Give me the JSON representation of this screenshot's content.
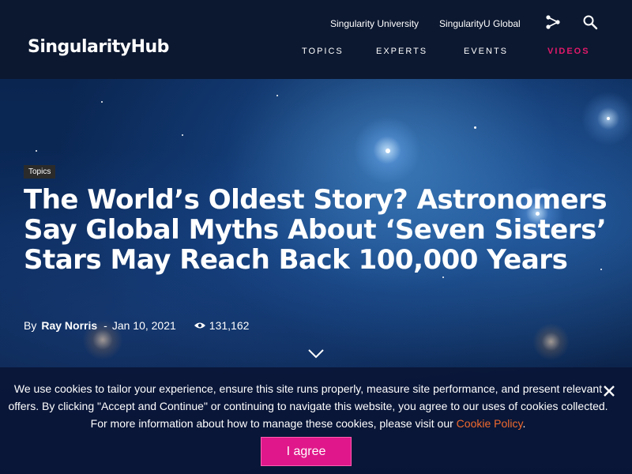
{
  "header": {
    "logo": "SingularityHub",
    "top_links": [
      "Singularity University",
      "SingularityU Global"
    ],
    "nav": [
      "TOPICS",
      "EXPERTS",
      "EVENTS",
      "VIDEOS"
    ],
    "active_nav_color": "#e3196a",
    "icons": [
      "share-icon",
      "search-icon"
    ]
  },
  "article": {
    "tag": "Topics",
    "title": "The World’s Oldest Story? Astronomers Say Global Myths About ‘Seven Sisters’ Stars May Reach Back 100,000 Years",
    "by_label": "By",
    "author": "Ray Norris",
    "date_sep": "-",
    "date": "Jan 10, 2021",
    "views": "131,162"
  },
  "cookie": {
    "text_before": "We use cookies to tailor your experience, ensure this site runs properly, measure site performance, and present relevant offers. By clicking \"Accept and Continue\" or continuing to navigate this website, you agree to our uses of cookies collected. For more information about how to manage these cookies, please visit our ",
    "link_text": "Cookie Policy",
    "text_after": ".",
    "button_label": "I agree",
    "button_color": "#e0178a",
    "link_color": "#f26a2e"
  }
}
